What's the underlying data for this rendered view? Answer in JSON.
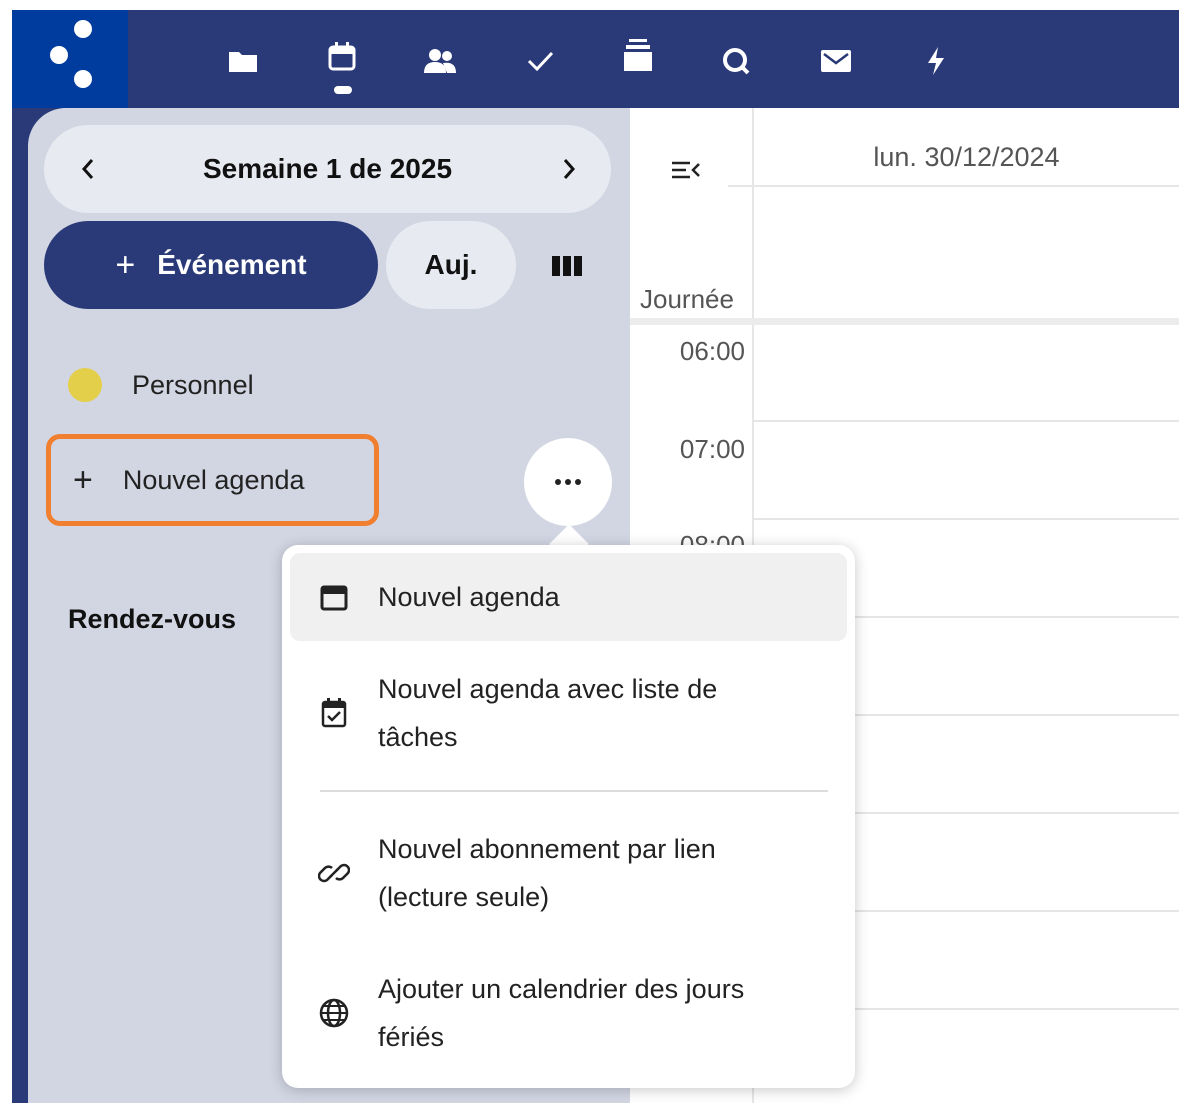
{
  "topbar": {
    "nav_icons": [
      "folder-icon",
      "calendar-icon",
      "contacts-icon",
      "check-icon",
      "deck-icon",
      "search-icon",
      "mail-icon",
      "activity-icon"
    ]
  },
  "sidebar": {
    "week_label": "Semaine 1 de 2025",
    "new_event_label": "Événement",
    "today_label": "Auj.",
    "calendar_name": "Personnel",
    "calendar_color": "#e3cf4a",
    "new_calendar_label": "Nouvel agenda",
    "appointments_label": "Rendez-vous"
  },
  "grid": {
    "day_header": "lun. 30/12/2024",
    "allday_label": "Journée",
    "hours": [
      "06:00",
      "07:00",
      "08:00"
    ]
  },
  "menu": {
    "items": [
      {
        "label": "Nouvel agenda",
        "icon": "calendar-icon"
      },
      {
        "label_line1": "Nouvel agenda avec liste de",
        "label_line2": "tâches",
        "icon": "calendar-check-icon"
      },
      {
        "label_line1": "Nouvel abonnement par lien",
        "label_line2": "(lecture seule)",
        "icon": "link-icon"
      },
      {
        "label_line1": "Ajouter un calendrier des jours",
        "label_line2": "fériés",
        "icon": "globe-icon"
      }
    ]
  },
  "colors": {
    "header_bg": "#2a3a78",
    "logo_bg": "#003c9e",
    "sidebar_bg": "#d2d6e3",
    "highlight": "#f08030"
  }
}
